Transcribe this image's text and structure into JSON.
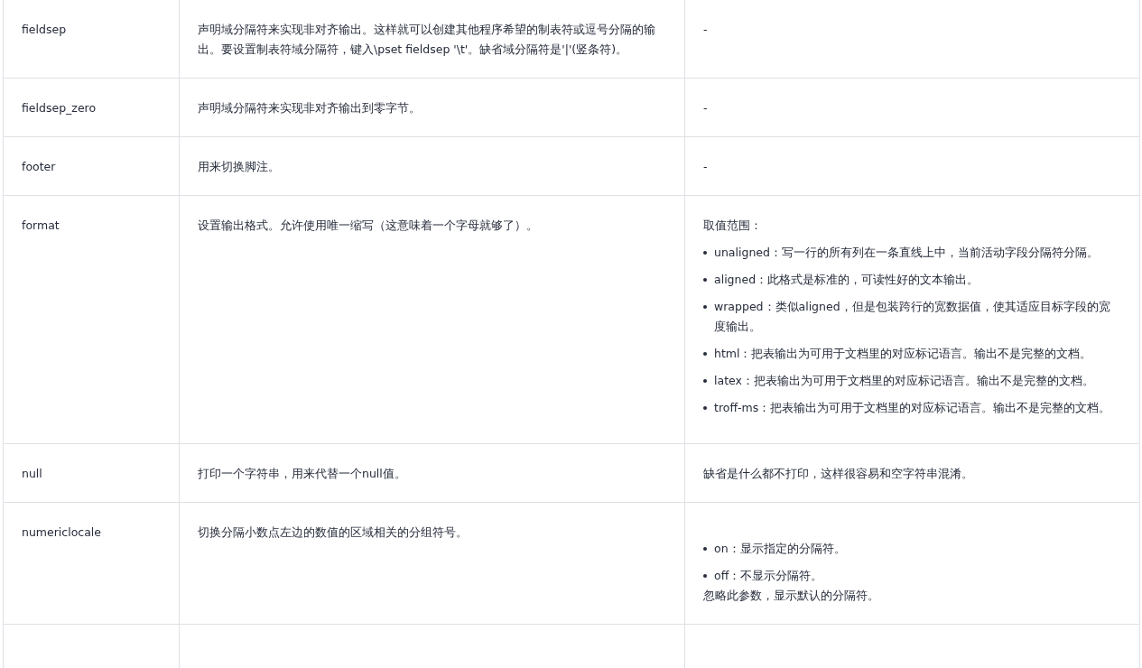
{
  "table": {
    "rows": [
      {
        "name": "fieldsep",
        "description": "声明域分隔符来实现非对齐输出。这样就可以创建其他程序希望的制表符或逗号分隔的输出。要设置制表符域分隔符，键入\\pset fieldsep '\\t'。缺省域分隔符是'|'(竖条符)。",
        "value": [
          {
            "kind": "text",
            "text": "-"
          }
        ]
      },
      {
        "name": "fieldsep_zero",
        "description": "声明域分隔符来实现非对齐输出到零字节。",
        "value": [
          {
            "kind": "text",
            "text": "-"
          }
        ]
      },
      {
        "name": "footer",
        "description": "用来切换脚注。",
        "value": [
          {
            "kind": "text",
            "text": "-"
          }
        ]
      },
      {
        "name": "format",
        "description": "设置输出格式。允许使用唯一缩写（这意味着一个字母就够了）。",
        "value": [
          {
            "kind": "text",
            "text": "取值范围："
          },
          {
            "kind": "bullets",
            "items": [
              "unaligned：写一行的所有列在一条直线上中，当前活动字段分隔符分隔。",
              "aligned：此格式是标准的，可读性好的文本输出。",
              "wrapped：类似aligned，但是包装跨行的宽数据值，使其适应目标字段的宽度输出。",
              "html：把表输出为可用于文档里的对应标记语言。输出不是完整的文档。",
              "latex：把表输出为可用于文档里的对应标记语言。输出不是完整的文档。",
              "troff-ms：把表输出为可用于文档里的对应标记语言。输出不是完整的文档。"
            ]
          }
        ]
      },
      {
        "name": "null",
        "description": "打印一个字符串，用来代替一个null值。",
        "value": [
          {
            "kind": "text",
            "text": "缺省是什么都不打印，这样很容易和空字符串混淆。"
          }
        ]
      },
      {
        "name": "numericlocale",
        "description": "切换分隔小数点左边的数值的区域相关的分组符号。",
        "value": [
          {
            "kind": "bullets",
            "items": [
              "on：显示指定的分隔符。",
              "off：不显示分隔符。"
            ]
          },
          {
            "kind": "note",
            "text": "忽略此参数，显示默认的分隔符。"
          }
        ]
      }
    ]
  }
}
